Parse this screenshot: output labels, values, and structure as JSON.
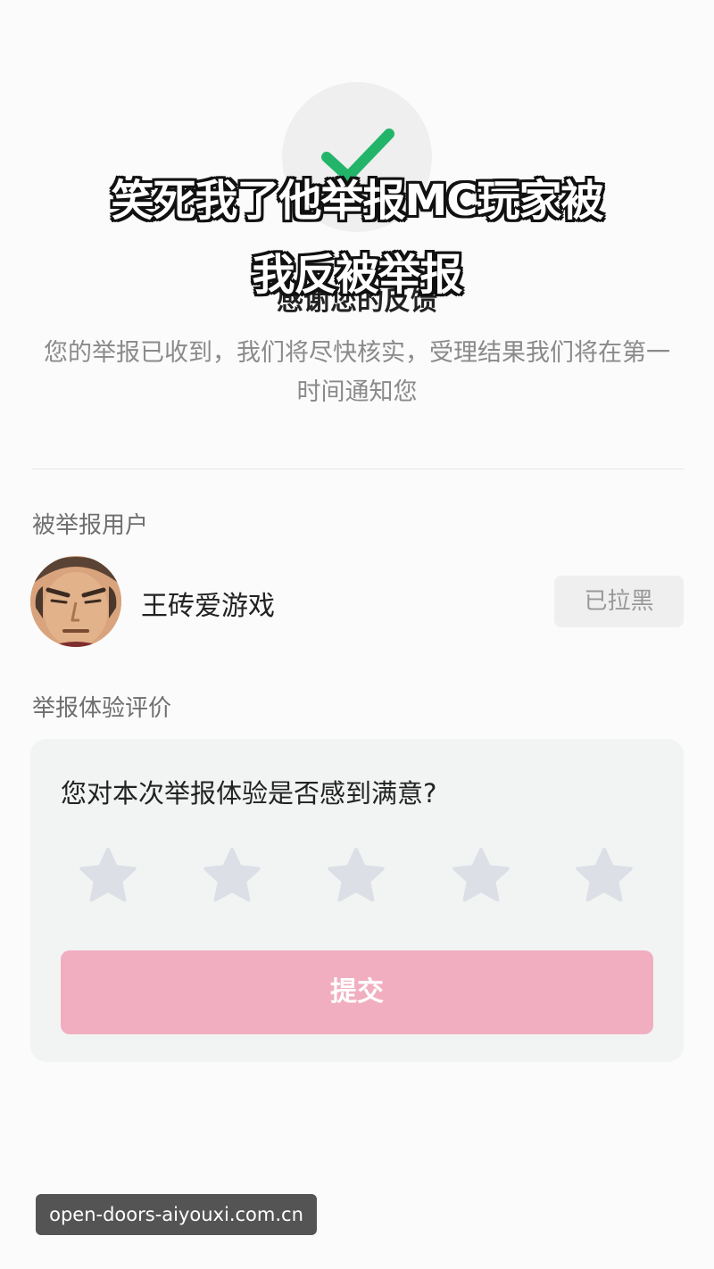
{
  "overlay_caption": {
    "line1": "笑死我了他举报MC玩家被",
    "line2": "我反被举报"
  },
  "success": {
    "icon": "check-icon",
    "title": "感谢您的反馈",
    "description": "您的举报已收到，我们将尽快核实，受理结果我们将在第一时间通知您"
  },
  "reported_user": {
    "section_label": "被举报用户",
    "name": "王砖爱游戏",
    "blocked_label": "已拉黑"
  },
  "rating": {
    "section_label": "举报体验评价",
    "question": "您对本次举报体验是否感到满意?",
    "stars_total": 5,
    "stars_selected": 0,
    "submit_label": "提交"
  },
  "watermark": "open-doors-aiyouxi.com.cn",
  "colors": {
    "accent_check": "#22b56a",
    "submit_button": "#f1aec0",
    "star_inactive": "#dcdfe6"
  }
}
